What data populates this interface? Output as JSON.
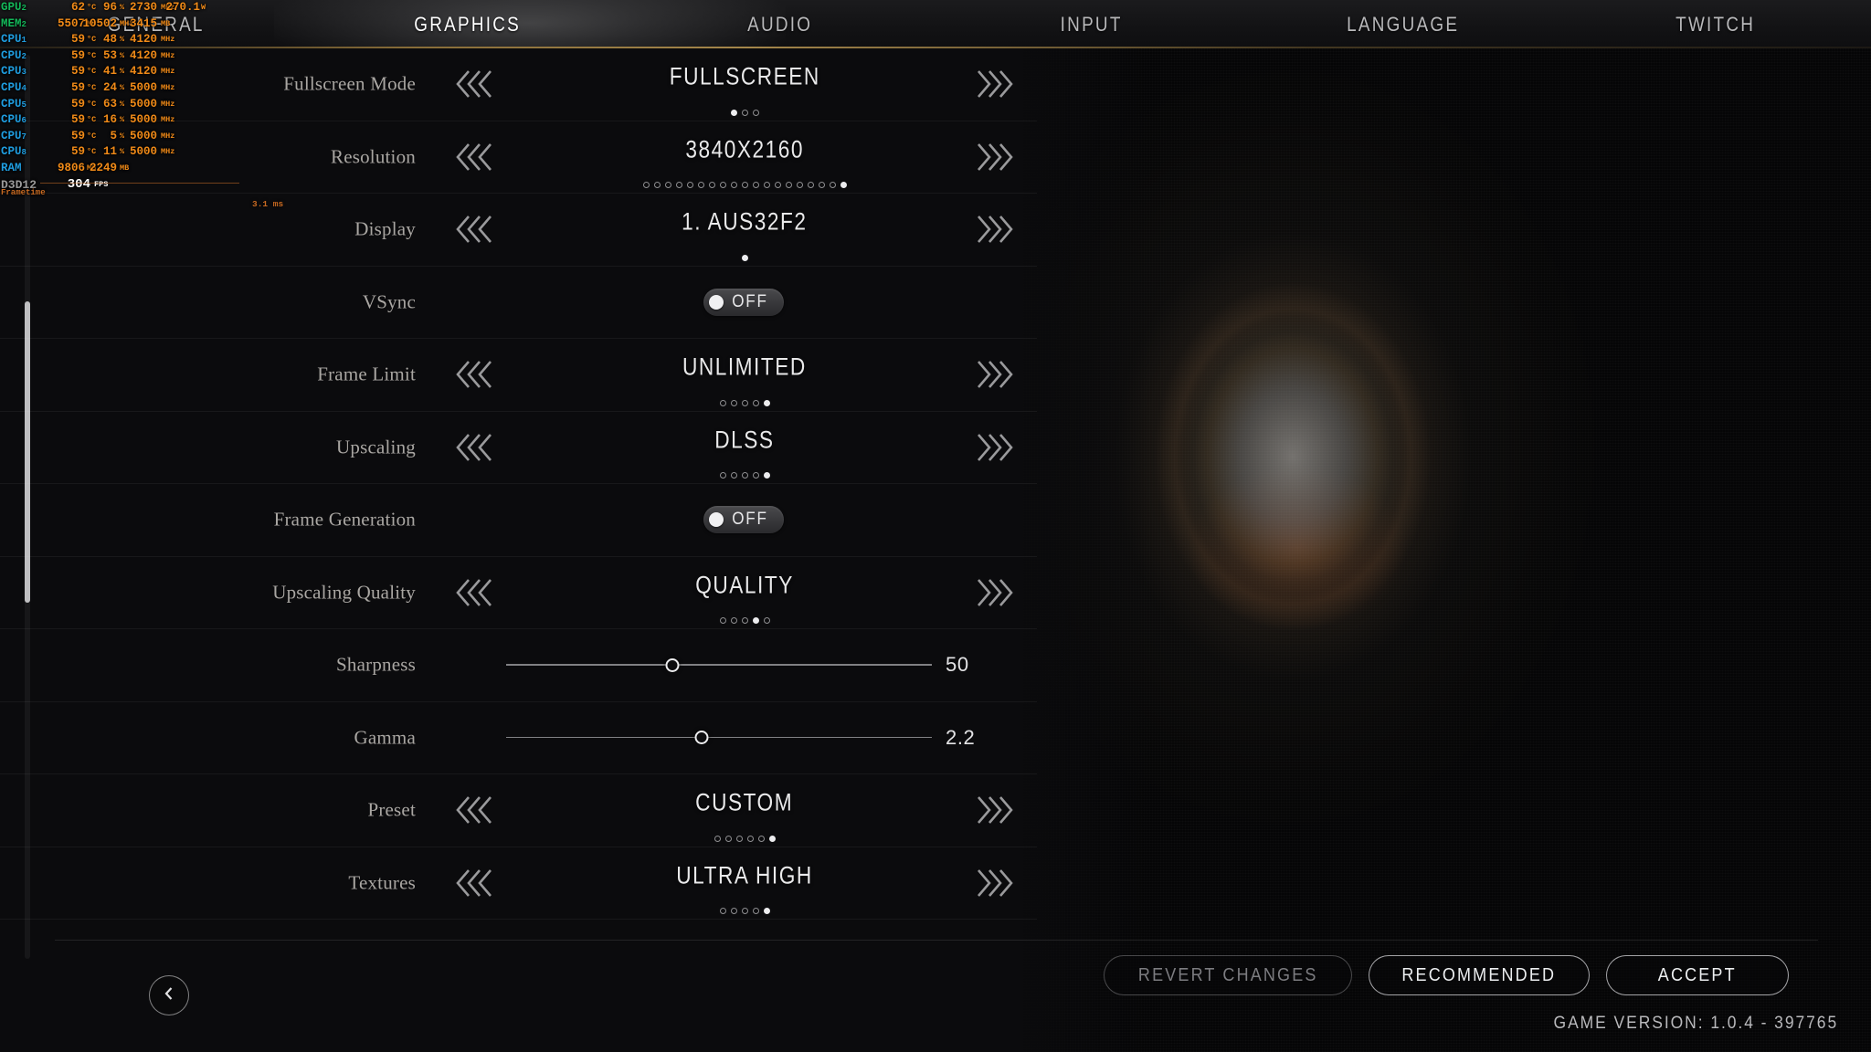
{
  "tabs": [
    {
      "label": "GENERAL",
      "active": false
    },
    {
      "label": "GRAPHICS",
      "active": true
    },
    {
      "label": "AUDIO",
      "active": false
    },
    {
      "label": "INPUT",
      "active": false
    },
    {
      "label": "LANGUAGE",
      "active": false
    },
    {
      "label": "TWITCH",
      "active": false
    }
  ],
  "settings": [
    {
      "type": "selector",
      "label": "Fullscreen Mode",
      "value": "FULLSCREEN",
      "dots": 3,
      "index": 1
    },
    {
      "type": "selector",
      "label": "Resolution",
      "value": "3840X2160",
      "dots": 19,
      "index": 19
    },
    {
      "type": "selector",
      "label": "Display",
      "value": "1. AUS32F2",
      "dots": 1,
      "index": 1
    },
    {
      "type": "toggle",
      "label": "VSync",
      "value": "OFF",
      "on": false
    },
    {
      "type": "selector",
      "label": "Frame Limit",
      "value": "UNLIMITED",
      "dots": 5,
      "index": 5
    },
    {
      "type": "selector",
      "label": "Upscaling",
      "value": "DLSS",
      "dots": 5,
      "index": 5
    },
    {
      "type": "toggle",
      "label": "Frame Generation",
      "value": "OFF",
      "on": false
    },
    {
      "type": "selector",
      "label": "Upscaling Quality",
      "value": "QUALITY",
      "dots": 5,
      "index": 4
    },
    {
      "type": "slider",
      "label": "Sharpness",
      "value": "50",
      "percent": 39
    },
    {
      "type": "slider",
      "label": "Gamma",
      "value": "2.2",
      "percent": 46
    },
    {
      "type": "selector",
      "label": "Preset",
      "value": "CUSTOM",
      "dots": 6,
      "index": 6
    },
    {
      "type": "selector",
      "label": "Textures",
      "value": "ULTRA HIGH",
      "dots": 5,
      "index": 5
    }
  ],
  "footer": {
    "back_icon": "chevron-left-icon",
    "revert_label": "REVERT CHANGES",
    "recommended_label": "RECOMMENDED",
    "accept_label": "ACCEPT",
    "version": "GAME VERSION: 1.0.4 - 397765"
  },
  "overlay": {
    "frametime_label": "Frametime",
    "frametime_ms": "3.1 ms",
    "rows": [
      {
        "name": "GPU",
        "sub": "2",
        "cls": "gpu",
        "c1": "62",
        "u1": "°C",
        "c2": "96",
        "u2": "%",
        "c3": "2730",
        "u3": "MHz",
        "c4": "270.1",
        "u4": "W"
      },
      {
        "name": "MEM",
        "sub": "2",
        "cls": "mem",
        "c1": "5507",
        "u1": "MB",
        "c2": "10502",
        "u2": "MHz",
        "c3": "3415",
        "u3": "MB",
        "c4": "",
        "u4": ""
      },
      {
        "name": "CPU",
        "sub": "1",
        "cls": "cpu",
        "c1": "59",
        "u1": "°C",
        "c2": "48",
        "u2": "%",
        "c3": "4120",
        "u3": "MHz",
        "c4": "",
        "u4": ""
      },
      {
        "name": "CPU",
        "sub": "2",
        "cls": "cpu",
        "c1": "59",
        "u1": "°C",
        "c2": "53",
        "u2": "%",
        "c3": "4120",
        "u3": "MHz",
        "c4": "",
        "u4": ""
      },
      {
        "name": "CPU",
        "sub": "3",
        "cls": "cpu",
        "c1": "59",
        "u1": "°C",
        "c2": "41",
        "u2": "%",
        "c3": "4120",
        "u3": "MHz",
        "c4": "",
        "u4": ""
      },
      {
        "name": "CPU",
        "sub": "4",
        "cls": "cpu",
        "c1": "59",
        "u1": "°C",
        "c2": "24",
        "u2": "%",
        "c3": "5000",
        "u3": "MHz",
        "c4": "",
        "u4": ""
      },
      {
        "name": "CPU",
        "sub": "5",
        "cls": "cpu",
        "c1": "59",
        "u1": "°C",
        "c2": "63",
        "u2": "%",
        "c3": "5000",
        "u3": "MHz",
        "c4": "",
        "u4": ""
      },
      {
        "name": "CPU",
        "sub": "6",
        "cls": "cpu",
        "c1": "59",
        "u1": "°C",
        "c2": "16",
        "u2": "%",
        "c3": "5000",
        "u3": "MHz",
        "c4": "",
        "u4": ""
      },
      {
        "name": "CPU",
        "sub": "7",
        "cls": "cpu",
        "c1": "59",
        "u1": "°C",
        "c2": "5",
        "u2": "%",
        "c3": "5000",
        "u3": "MHz",
        "c4": "",
        "u4": ""
      },
      {
        "name": "CPU",
        "sub": "8",
        "cls": "cpu",
        "c1": "59",
        "u1": "°C",
        "c2": "11",
        "u2": "%",
        "c3": "5000",
        "u3": "MHz",
        "c4": "",
        "u4": ""
      },
      {
        "name": "RAM",
        "sub": "",
        "cls": "ram",
        "c1": "9806",
        "u1": "MB",
        "c2": "2249",
        "u2": "MB",
        "c3": "",
        "u3": "",
        "c4": "",
        "u4": ""
      }
    ],
    "api": "D3D12",
    "fps": "304",
    "fps_unit": "FPS"
  }
}
